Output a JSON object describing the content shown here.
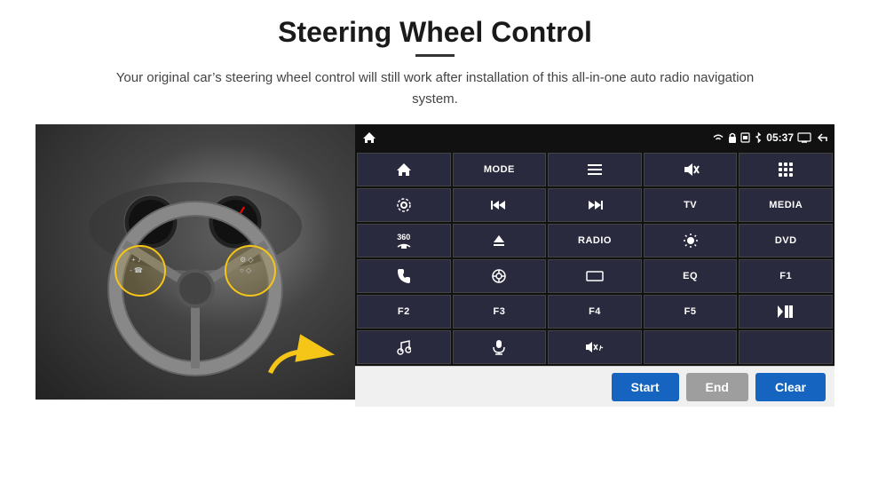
{
  "header": {
    "title": "Steering Wheel Control",
    "subtitle": "Your original car’s steering wheel control will still work after installation of this all-in-one auto radio navigation system."
  },
  "statusBar": {
    "time": "05:37",
    "icons": [
      "wifi",
      "lock",
      "sim",
      "bluetooth",
      "screen",
      "back"
    ]
  },
  "buttons": [
    {
      "id": "r0c0",
      "type": "icon",
      "icon": "⌂",
      "label": "home"
    },
    {
      "id": "r0c1",
      "type": "text",
      "label": "MODE"
    },
    {
      "id": "r0c2",
      "type": "icon",
      "icon": "≡",
      "label": "menu"
    },
    {
      "id": "r0c3",
      "type": "icon",
      "icon": "🔇",
      "label": "mute"
    },
    {
      "id": "r0c4",
      "type": "icon",
      "icon": "⠿",
      "label": "apps"
    },
    {
      "id": "r1c0",
      "type": "icon",
      "icon": "⚙",
      "label": "settings"
    },
    {
      "id": "r1c1",
      "type": "icon",
      "icon": "⏮",
      "label": "prev"
    },
    {
      "id": "r1c2",
      "type": "icon",
      "icon": "⏭",
      "label": "next"
    },
    {
      "id": "r1c3",
      "type": "text",
      "label": "TV"
    },
    {
      "id": "r1c4",
      "type": "text",
      "label": "MEDIA"
    },
    {
      "id": "r2c0",
      "type": "text",
      "label": "360",
      "sub": "car"
    },
    {
      "id": "r2c1",
      "type": "icon",
      "icon": "▲",
      "label": "eject"
    },
    {
      "id": "r2c2",
      "type": "text",
      "label": "RADIO"
    },
    {
      "id": "r2c3",
      "type": "icon",
      "icon": "☀",
      "label": "brightness"
    },
    {
      "id": "r2c4",
      "type": "text",
      "label": "DVD"
    },
    {
      "id": "r3c0",
      "type": "icon",
      "icon": "📞",
      "label": "phone"
    },
    {
      "id": "r3c1",
      "type": "icon",
      "icon": "🔄",
      "label": "navi"
    },
    {
      "id": "r3c2",
      "type": "icon",
      "icon": "▬",
      "label": "display"
    },
    {
      "id": "r3c3",
      "type": "text",
      "label": "EQ"
    },
    {
      "id": "r3c4",
      "type": "text",
      "label": "F1"
    },
    {
      "id": "r4c0",
      "type": "text",
      "label": "F2"
    },
    {
      "id": "r4c1",
      "type": "text",
      "label": "F3"
    },
    {
      "id": "r4c2",
      "type": "text",
      "label": "F4"
    },
    {
      "id": "r4c3",
      "type": "text",
      "label": "F5"
    },
    {
      "id": "r4c4",
      "type": "icon",
      "icon": "⏯",
      "label": "play-pause"
    },
    {
      "id": "r5c0",
      "type": "icon",
      "icon": "♪",
      "label": "music"
    },
    {
      "id": "r5c1",
      "type": "icon",
      "icon": "🎤",
      "label": "mic"
    },
    {
      "id": "r5c2",
      "type": "icon",
      "icon": "🔊",
      "label": "volume"
    },
    {
      "id": "r5c3",
      "type": "text",
      "label": ""
    },
    {
      "id": "r5c4",
      "type": "text",
      "label": ""
    }
  ],
  "actionBar": {
    "startLabel": "Start",
    "endLabel": "End",
    "clearLabel": "Clear"
  }
}
